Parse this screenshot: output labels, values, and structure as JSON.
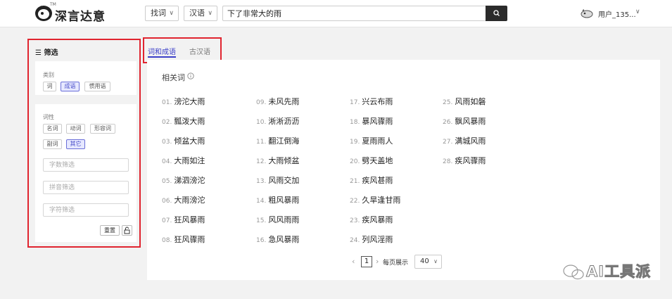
{
  "header": {
    "logo_text": "深言达意",
    "logo_tm": "TM",
    "search_type": "找词",
    "lang": "汉语",
    "search_value": "下了非常大的雨",
    "user_name": "用户_135..."
  },
  "filter": {
    "title": "筛选",
    "category_label": "类别",
    "categories": [
      "词",
      "成语",
      "惯用语"
    ],
    "pos_label": "词性",
    "pos": [
      "名词",
      "动词",
      "形容词",
      "副词",
      "其它"
    ],
    "char_count_placeholder": "字数筛选",
    "pinyin_placeholder": "拼音筛选",
    "char_placeholder": "字符筛选",
    "reset_label": "重置"
  },
  "tabs": [
    "词和成语",
    "古汉语"
  ],
  "section_title": "相关词",
  "words": [
    {
      "n": "01.",
      "w": "滂沱大雨"
    },
    {
      "n": "02.",
      "w": "瓢泼大雨"
    },
    {
      "n": "03.",
      "w": "倾盆大雨"
    },
    {
      "n": "04.",
      "w": "大雨如注"
    },
    {
      "n": "05.",
      "w": "涕泗滂沱"
    },
    {
      "n": "06.",
      "w": "大雨滂沱"
    },
    {
      "n": "07.",
      "w": "狂风暴雨"
    },
    {
      "n": "08.",
      "w": "狂风骤雨"
    },
    {
      "n": "09.",
      "w": "未风先雨"
    },
    {
      "n": "10.",
      "w": "淅淅沥沥"
    },
    {
      "n": "11.",
      "w": "翻江倒海"
    },
    {
      "n": "12.",
      "w": "大雨倾盆"
    },
    {
      "n": "13.",
      "w": "风雨交加"
    },
    {
      "n": "14.",
      "w": "粗风暴雨"
    },
    {
      "n": "15.",
      "w": "风风雨雨"
    },
    {
      "n": "16.",
      "w": "急风暴雨"
    },
    {
      "n": "17.",
      "w": "兴云布雨"
    },
    {
      "n": "18.",
      "w": "暴风骤雨"
    },
    {
      "n": "19.",
      "w": "夏雨雨人"
    },
    {
      "n": "20.",
      "w": "劈天盖地"
    },
    {
      "n": "21.",
      "w": "疾风甚雨"
    },
    {
      "n": "22.",
      "w": "久旱逢甘雨"
    },
    {
      "n": "23.",
      "w": "疾风暴雨"
    },
    {
      "n": "24.",
      "w": "列风淫雨"
    },
    {
      "n": "25.",
      "w": "风雨如磐"
    },
    {
      "n": "26.",
      "w": "飘风暴雨"
    },
    {
      "n": "27.",
      "w": "满城风雨"
    },
    {
      "n": "28.",
      "w": "疾风骤雨"
    }
  ],
  "pagination": {
    "current_page": "1",
    "per_page_label": "每页展示",
    "per_page": "40"
  },
  "watermark": "AI工具派"
}
